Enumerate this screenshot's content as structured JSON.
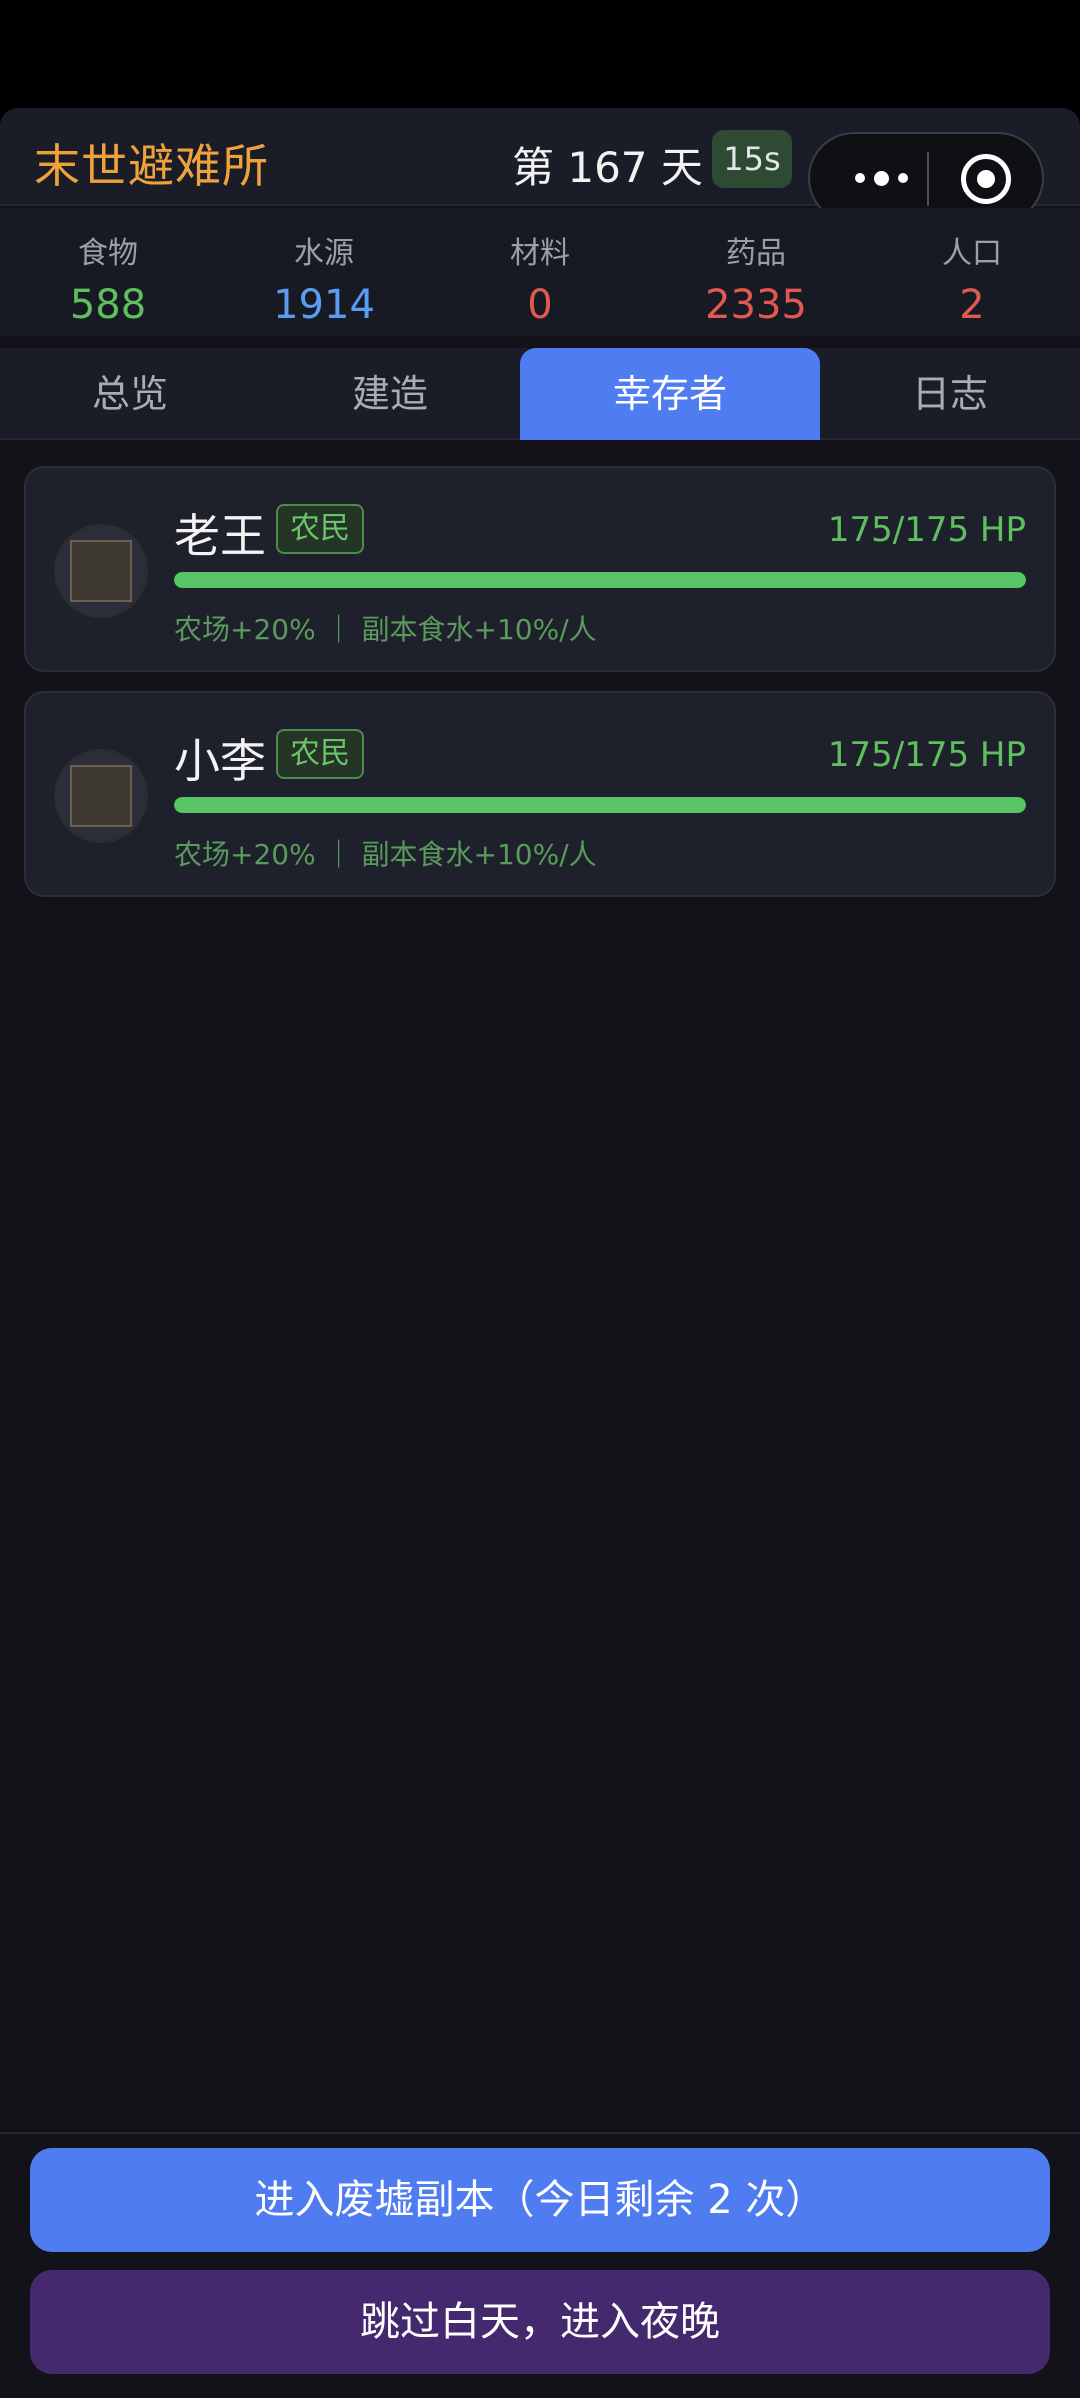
{
  "header": {
    "title": "末世避难所",
    "day_label": "第 167 天",
    "timer": "15s"
  },
  "resources": [
    {
      "label": "食物",
      "value": "588",
      "color": "#5fbf5f"
    },
    {
      "label": "水源",
      "value": "1914",
      "color": "#5b9cf0"
    },
    {
      "label": "材料",
      "value": "0",
      "color": "#e05a52"
    },
    {
      "label": "药品",
      "value": "2335",
      "color": "#e05a52"
    },
    {
      "label": "人口",
      "value": "2",
      "color": "#e05a52"
    }
  ],
  "tabs": [
    {
      "label": "总览",
      "active": false
    },
    {
      "label": "建造",
      "active": false
    },
    {
      "label": "幸存者",
      "active": true
    },
    {
      "label": "日志",
      "active": false
    }
  ],
  "survivors": [
    {
      "name": "老王",
      "role": "农民",
      "hp": "175/175 HP",
      "hp_fraction": 1.0,
      "buffs": "农场+20% ｜ 副本食水+10%/人"
    },
    {
      "name": "小李",
      "role": "农民",
      "hp": "175/175 HP",
      "hp_fraction": 1.0,
      "buffs": "农场+20% ｜ 副本食水+10%/人"
    }
  ],
  "actions": {
    "enter_ruins": "进入废墟副本（今日剩余 2 次）",
    "skip_day": "跳过白天，进入夜晚"
  },
  "colors": {
    "accent": "#4f7cf0",
    "title": "#f0a23a",
    "secondary_button": "#45296f",
    "hp": "#57c565"
  },
  "icons": {
    "more": "more-dots-icon",
    "close": "target-close-icon",
    "avatar": "survivor-portrait"
  }
}
